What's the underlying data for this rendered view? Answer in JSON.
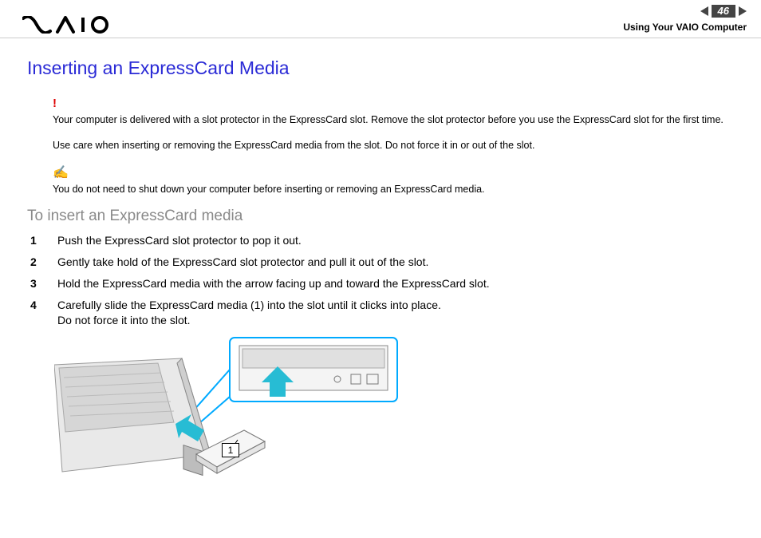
{
  "header": {
    "page_number": "46",
    "breadcrumb": "Using Your VAIO Computer",
    "logo_letters": [
      "V",
      "A",
      "I",
      "O"
    ]
  },
  "title": "Inserting an ExpressCard Media",
  "warning_text": "Your computer is delivered with a slot protector in the ExpressCard slot. Remove the slot protector before you use the ExpressCard slot for the first time.",
  "care_text": "Use care when inserting or removing the ExpressCard media from the slot. Do not force it in or out of the slot.",
  "tip_text": "You do not need to shut down your computer before inserting or removing an ExpressCard media.",
  "subhead": "To insert an ExpressCard media",
  "steps": [
    "Push the ExpressCard slot protector to pop it out.",
    "Gently take hold of the ExpressCard slot protector and pull it out of the slot.",
    "Hold the ExpressCard media with the arrow facing up and toward the ExpressCard slot.",
    "Carefully slide the ExpressCard media (1) into the slot until it clicks into place.\nDo not force it into the slot."
  ],
  "callout_label": "1",
  "icons": {
    "warning": "!",
    "tip": "✍"
  }
}
